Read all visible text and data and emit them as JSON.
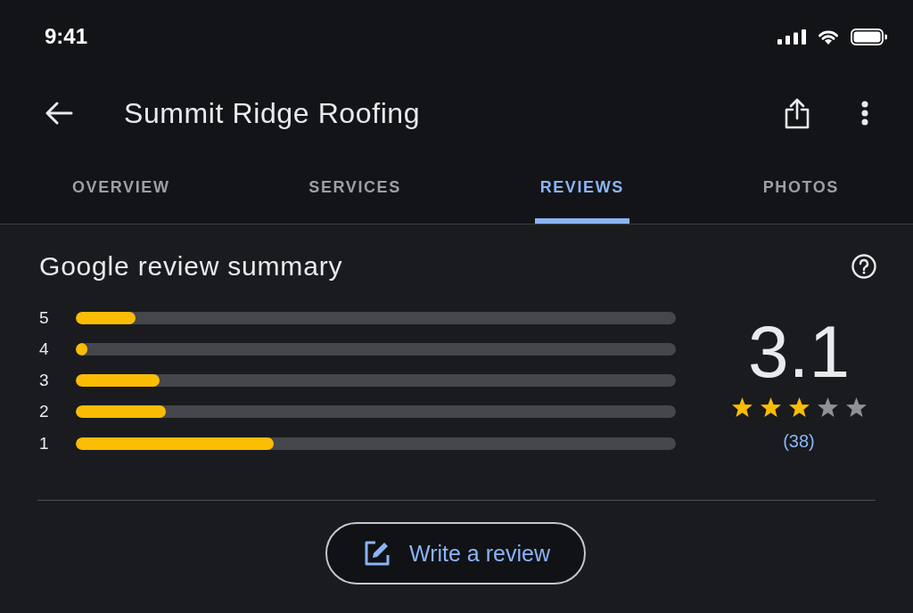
{
  "status_bar": {
    "time": "9:41"
  },
  "header": {
    "title": "Summit Ridge Roofing"
  },
  "tabs": [
    {
      "label": "OVERVIEW",
      "selected": false
    },
    {
      "label": "SERVICES",
      "selected": false
    },
    {
      "label": "REVIEWS",
      "selected": true
    },
    {
      "label": "PHOTOS",
      "selected": false
    }
  ],
  "summary": {
    "title": "Google review summary",
    "distribution": [
      {
        "label": "5",
        "level": 0.1
      },
      {
        "label": "4",
        "level": 0.02
      },
      {
        "label": "3",
        "level": 0.14
      },
      {
        "label": "2",
        "level": 0.15
      },
      {
        "label": "1",
        "level": 0.33
      }
    ],
    "rating": "3.1",
    "stars": 3,
    "count": "(38)"
  },
  "write_review_button": {
    "label": "Write a review"
  }
}
